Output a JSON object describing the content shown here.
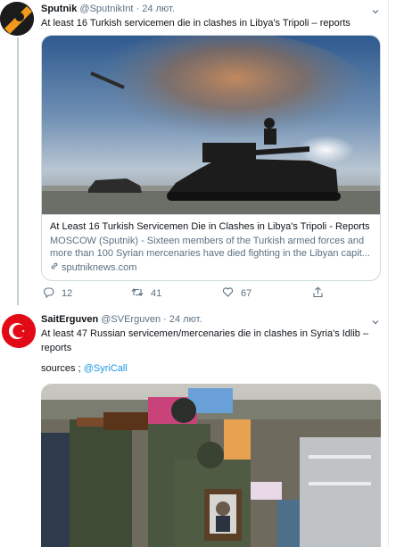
{
  "tweets": [
    {
      "display_name": "Sputnik",
      "handle": "@SputnikInt",
      "separator": "·",
      "time": "24 лют.",
      "text": "At least 16 Turkish servicemen die in clashes in Libya's Tripoli – reports",
      "card": {
        "title": "At Least 16 Turkish Servicemen Die in Clashes in Libya's Tripoli - Reports",
        "description": "MOSCOW (Sputnik) - Sixteen members of the Turkish armed forces and more than 100 Syrian mercenaries have died fighting in the Libyan capit...",
        "domain": "sputniknews.com"
      },
      "actions": {
        "replies": "12",
        "retweets": "41",
        "likes": "67"
      }
    },
    {
      "display_name": "SaitErguven",
      "handle": "@SVErguven",
      "separator": "·",
      "time": "24 лют.",
      "text": "At least 47 Russian servicemen/mercenaries die in clashes in Syria's Idlib – reports",
      "sources_label": "sources ;",
      "mention": "@SyriCall"
    }
  ],
  "icons": {
    "reply": "reply-icon",
    "retweet": "retweet-icon",
    "like": "heart-icon",
    "share": "share-icon",
    "link": "link-icon",
    "more": "chevron-down-icon"
  },
  "colors": {
    "text": "#0f1419",
    "secondary": "#5b7083",
    "link": "#1b95e0",
    "border": "#cfd9de"
  }
}
